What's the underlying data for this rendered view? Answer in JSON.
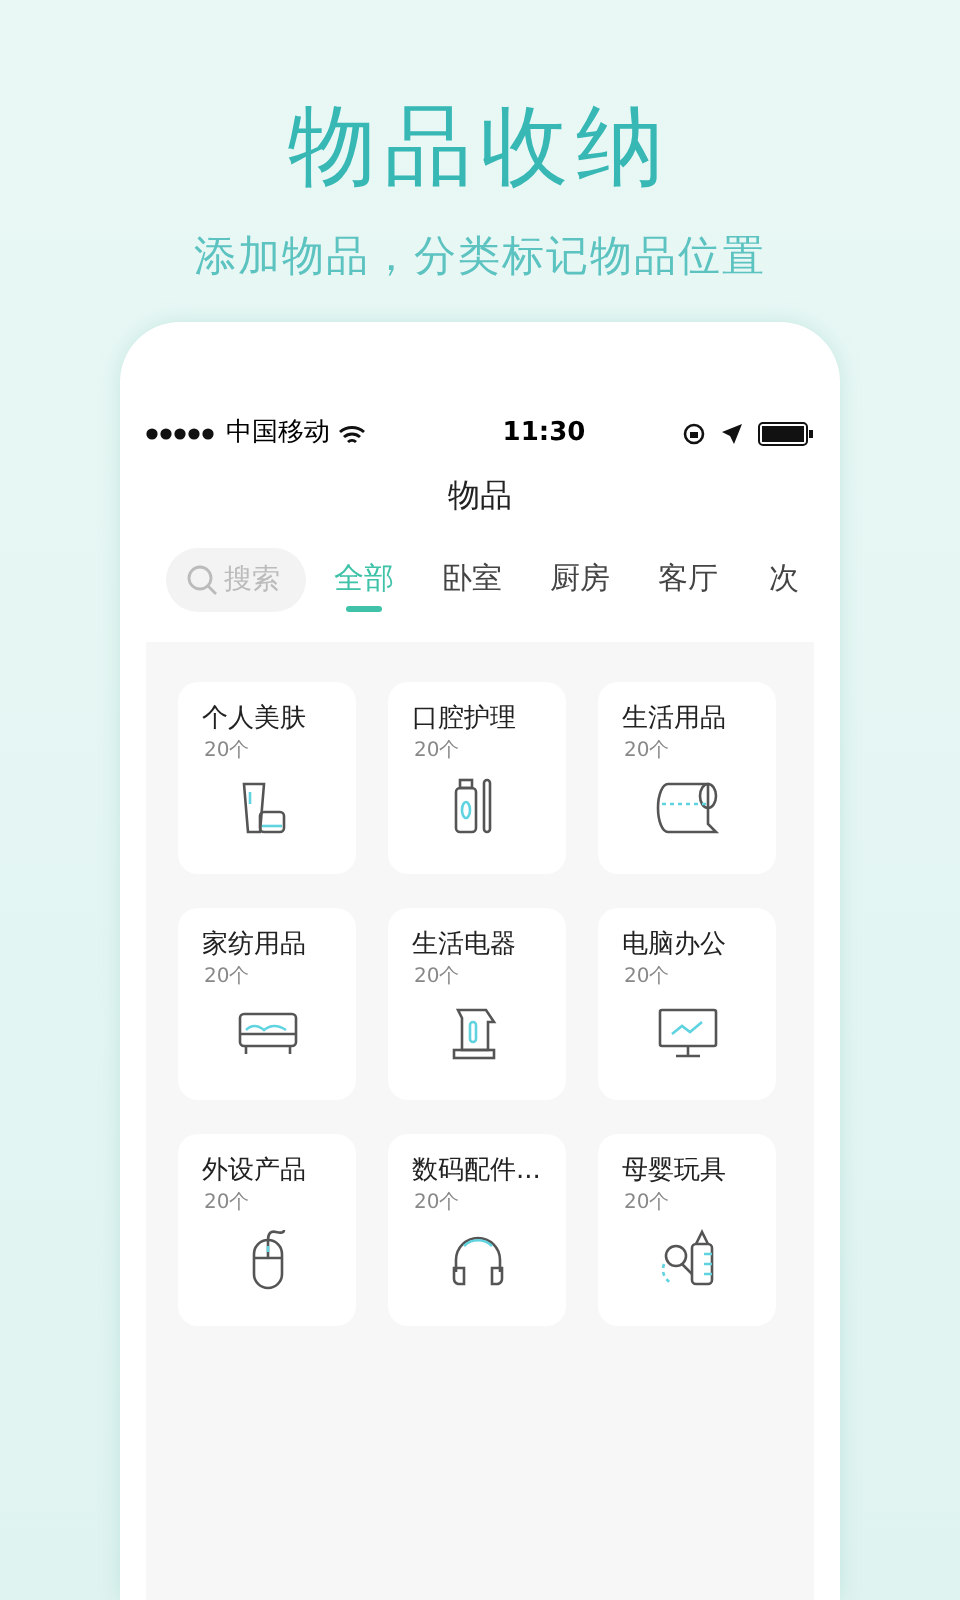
{
  "headline": "物品收纳",
  "subtitle": "添加物品，分类标记物品位置",
  "status_bar": {
    "carrier": "中国移动",
    "time": "11:30"
  },
  "page_title": "物品",
  "search": {
    "placeholder": "搜索"
  },
  "tabs": [
    {
      "label": "全部",
      "selected": true
    },
    {
      "label": "卧室",
      "selected": false
    },
    {
      "label": "厨房",
      "selected": false
    },
    {
      "label": "客厅",
      "selected": false
    },
    {
      "label": "次",
      "selected": false
    }
  ],
  "categories": [
    {
      "name": "个人美肤",
      "count": "20个"
    },
    {
      "name": "口腔护理",
      "count": "20个"
    },
    {
      "name": "生活用品",
      "count": "20个"
    },
    {
      "name": "家纺用品",
      "count": "20个"
    },
    {
      "name": "生活电器",
      "count": "20个"
    },
    {
      "name": "电脑办公",
      "count": "20个"
    },
    {
      "name": "外设产品",
      "count": "20个"
    },
    {
      "name": "数码配件...",
      "count": "20个"
    },
    {
      "name": "母婴玩具",
      "count": "20个"
    }
  ]
}
